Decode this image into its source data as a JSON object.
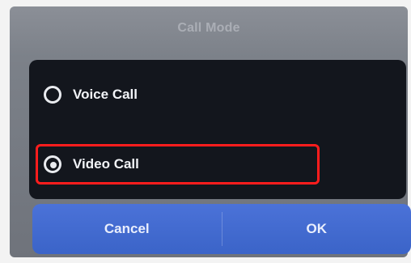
{
  "dialog": {
    "title": "Call Mode",
    "options": [
      {
        "label": "Voice Call",
        "selected": false
      },
      {
        "label": "Video Call",
        "selected": true
      }
    ],
    "buttons": {
      "cancel": "Cancel",
      "ok": "OK"
    }
  },
  "colors": {
    "highlight": "#ff1d1d",
    "button_bg": "#3b64c8",
    "panel_bg": "#13161d"
  },
  "icons": {
    "radio_unselected": "radio-unselected-icon",
    "radio_selected": "radio-selected-icon"
  }
}
